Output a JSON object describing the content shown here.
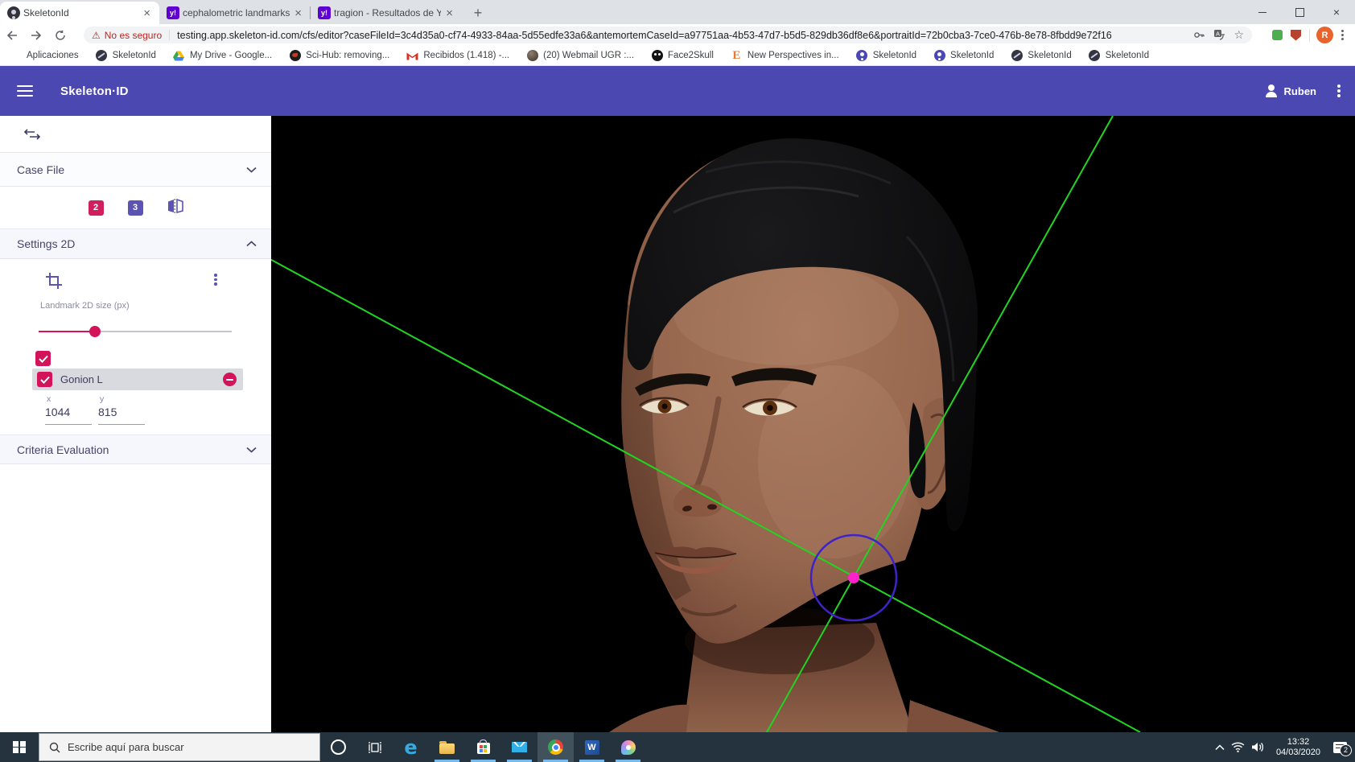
{
  "browser": {
    "tabs": [
      {
        "title": "SkeletonId",
        "favicon": "skeletonid-icon"
      },
      {
        "title": "cephalometric landmarks in obliq",
        "favicon": "yahoo-icon",
        "favicon_text": "y!"
      },
      {
        "title": "tragion - Resultados de Yahoo Es",
        "favicon": "yahoo-icon",
        "favicon_text": "y!"
      }
    ],
    "close_glyph": "×",
    "new_tab_glyph": "+",
    "security_chip": "No es seguro",
    "warning_glyph": "⚠",
    "url": "testing.app.skeleton-id.com/cfs/editor?caseFileId=3c4d35a0-cf74-4933-84aa-5d55edfe33a6&antemortemCaseId=a97751aa-4b53-47d7-b5d5-829db36df8e6&portraitId=72b0cba3-7ce0-476b-8e78-8fbdd9e72f16",
    "star_glyph": "☆",
    "profile_initial": "R",
    "bookmarks": [
      {
        "label": "Aplicaciones",
        "icon": "apps-grid-icon"
      },
      {
        "label": "SkeletonId",
        "icon": "globe-icon"
      },
      {
        "label": "My Drive - Google...",
        "icon": "drive-icon"
      },
      {
        "label": "Sci-Hub: removing...",
        "icon": "raven-icon"
      },
      {
        "label": "Recibidos (1.418) -...",
        "icon": "gmail-icon"
      },
      {
        "label": "(20) Webmail UGR :...",
        "icon": "sphere-icon"
      },
      {
        "label": "Face2Skull",
        "icon": "skull-icon"
      },
      {
        "label": "New Perspectives in...",
        "icon": "serif-e-icon",
        "glyph": "E"
      },
      {
        "label": "SkeletonId",
        "icon": "skeletonid-person-icon"
      },
      {
        "label": "SkeletonId",
        "icon": "skeletonid-person-icon"
      },
      {
        "label": "SkeletonId",
        "icon": "globe-icon"
      },
      {
        "label": "SkeletonId",
        "icon": "globe-icon"
      }
    ]
  },
  "app": {
    "title": "Skeleton·ID",
    "user": "Ruben",
    "header_color": "#4c48b2"
  },
  "sidebar": {
    "case_file_label": "Case File",
    "landmarks_2d_count": "2",
    "landmarks_3d_count": "3",
    "settings_2d_label": "Settings 2D",
    "landmark_size_label": "Landmark 2D size (px)",
    "slider_value_pct": 30,
    "landmark_name": "Gonion L",
    "coord_x_label": "x",
    "coord_y_label": "y",
    "coord_x_value": "1044",
    "coord_y_value": "815",
    "criteria_label": "Criteria Evaluation",
    "accent_color": "#d4145a",
    "indigo_color": "#5b54b4"
  },
  "viewport": {
    "colors": {
      "guide_line": "#22d422",
      "selection_circle": "#4023c7",
      "landmark_dot": "#ff22cc",
      "background": "#000000"
    }
  },
  "taskbar": {
    "search_placeholder": "Escribe aquí para buscar",
    "clock_time": "13:32",
    "clock_date": "04/03/2020",
    "notification_count": "2",
    "edge_glyph": "e",
    "word_glyph": "W"
  }
}
